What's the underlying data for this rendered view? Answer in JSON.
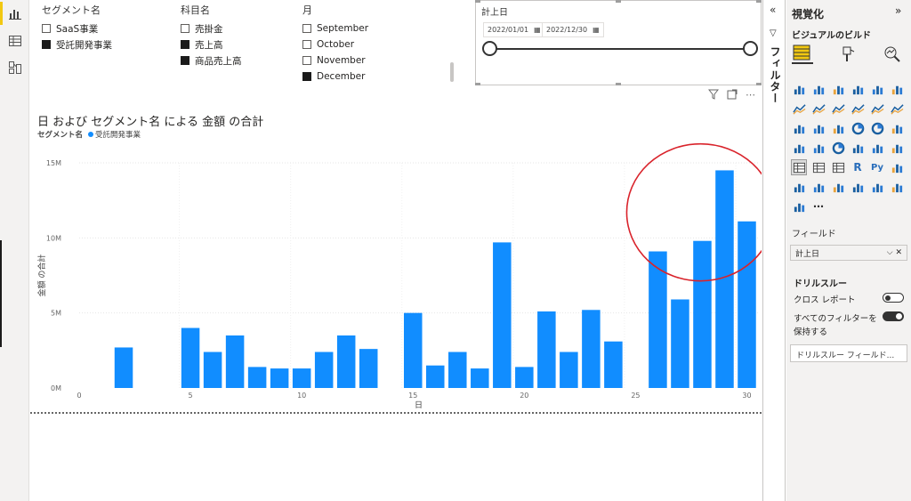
{
  "rail": {
    "icons": [
      "report-view-icon",
      "table-view-icon",
      "model-view-icon"
    ]
  },
  "slicers": {
    "segment": {
      "title": "セグメント名",
      "items": [
        {
          "label": "SaaS事業",
          "checked": false
        },
        {
          "label": "受託開発事業",
          "checked": true
        }
      ]
    },
    "account": {
      "title": "科目名",
      "items": [
        {
          "label": "売掛金",
          "checked": false
        },
        {
          "label": "売上高",
          "checked": true
        },
        {
          "label": "商品売上高",
          "checked": true
        }
      ]
    },
    "month": {
      "title": "月",
      "items": [
        {
          "label": "September",
          "checked": false
        },
        {
          "label": "October",
          "checked": false
        },
        {
          "label": "November",
          "checked": false
        },
        {
          "label": "December",
          "checked": true
        }
      ]
    }
  },
  "date_slicer": {
    "title": "計上日",
    "start": "2022/01/01",
    "end": "2022/12/30"
  },
  "visual_header": {
    "filter_icon": "filter-icon",
    "focus_icon": "focus-mode-icon",
    "more": "⋯"
  },
  "chart_data": {
    "type": "bar",
    "title": "日 および セグメント名 による 金額 の合計",
    "legend_title": "セグメント名",
    "series": [
      {
        "name": "受託開発事業",
        "color": "#118dff",
        "x": [
          2,
          5,
          6,
          7,
          8,
          9,
          10,
          11,
          12,
          13,
          15,
          16,
          17,
          18,
          19,
          20,
          21,
          22,
          23,
          24,
          26,
          27,
          28,
          29,
          30
        ],
        "values": [
          2.7,
          4.0,
          2.4,
          3.5,
          1.4,
          1.3,
          1.3,
          2.4,
          3.5,
          2.6,
          5.0,
          1.5,
          2.4,
          1.3,
          9.7,
          1.4,
          5.1,
          2.4,
          5.2,
          3.1,
          9.1,
          5.9,
          9.8,
          14.5,
          11.1
        ]
      }
    ],
    "xlabel": "日",
    "ylabel": "金額 の合計",
    "xlim": [
      0,
      30.5
    ],
    "ylim": [
      0,
      15
    ],
    "x_ticks": [
      0,
      5,
      10,
      15,
      20,
      25,
      30
    ],
    "y_ticks": [
      {
        "v": 0,
        "label": "0M"
      },
      {
        "v": 5,
        "label": "5M"
      },
      {
        "v": 10,
        "label": "10M"
      },
      {
        "v": 15,
        "label": "15M"
      }
    ],
    "annotation": {
      "type": "circle",
      "color": "#d9232b",
      "around_x": [
        26,
        30
      ]
    }
  },
  "filter_pane": {
    "label": "フィルター"
  },
  "viz_pane": {
    "title": "視覚化",
    "build_label": "ビジュアルのビルド",
    "field_label": "フィールド",
    "field_value": "計上日",
    "drillthrough": "ドリルスルー",
    "cross_report": "クロス レポート",
    "cross_report_on": false,
    "keep_filters_line1": "すべてのフィルターを",
    "keep_filters_line2": "保持する",
    "keep_filters_on": true,
    "drill_field_placeholder": "ドリルスルー フィールド..."
  }
}
